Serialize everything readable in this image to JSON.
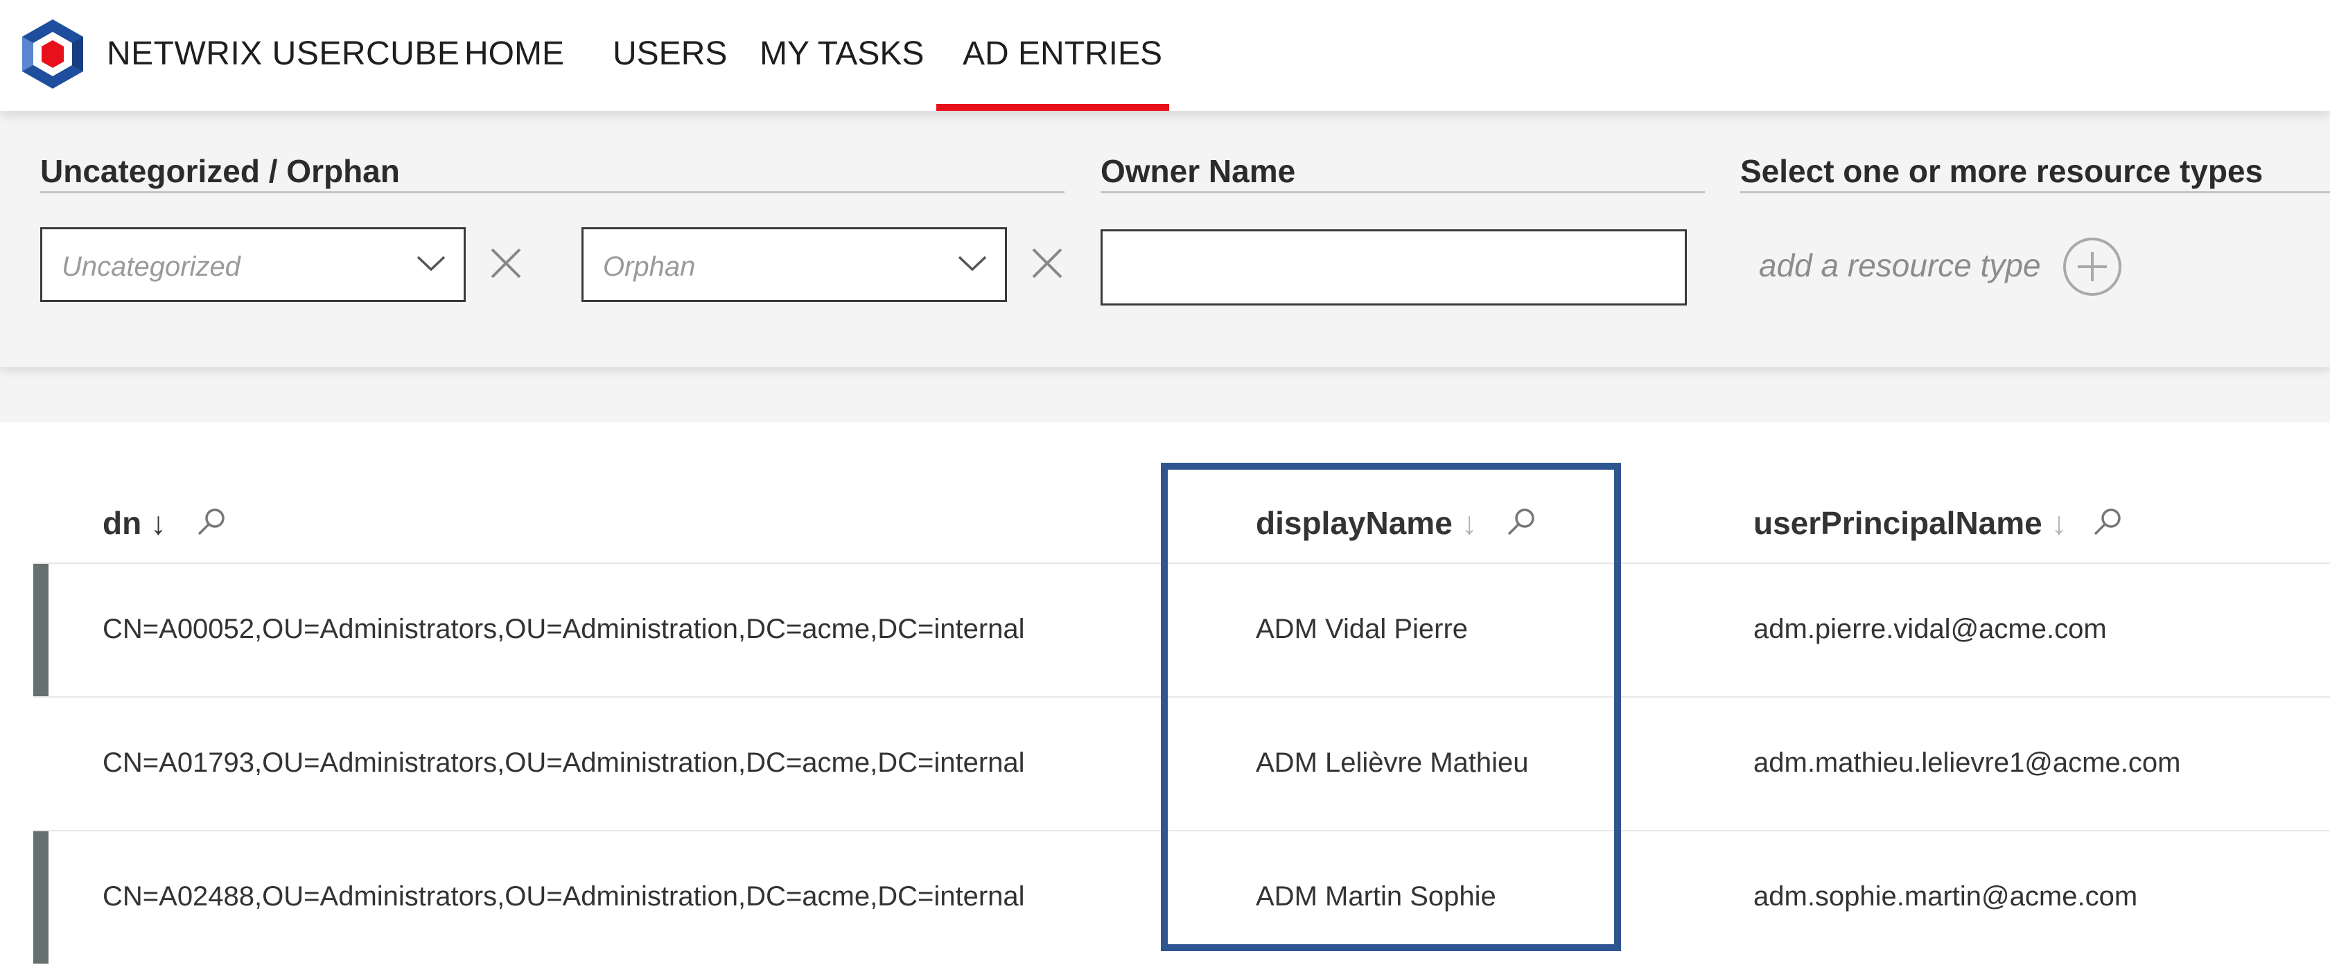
{
  "header": {
    "brand": "NETWRIX USERCUBE",
    "nav": [
      {
        "label": "HOME",
        "active": false
      },
      {
        "label": "USERS",
        "active": false
      },
      {
        "label": "MY TASKS",
        "active": false
      },
      {
        "label": "AD ENTRIES",
        "active": true
      }
    ],
    "accent_color": "#e8101b"
  },
  "filters": {
    "category_title": "Uncategorized / Orphan",
    "category_select_placeholder": "Uncategorized",
    "orphan_select_placeholder": "Orphan",
    "owner_title": "Owner Name",
    "owner_value": "",
    "resource_title": "Select one or more resource types",
    "resource_add_label": "add a resource type"
  },
  "table": {
    "columns": [
      {
        "label": "dn",
        "sort": "↓",
        "sort_active": true
      },
      {
        "label": "displayName",
        "sort": "↓",
        "sort_active": false
      },
      {
        "label": "userPrincipalName",
        "sort": "↓",
        "sort_active": false
      }
    ],
    "rows": [
      {
        "dn": "CN=A00052,OU=Administrators,OU=Administration,DC=acme,DC=internal",
        "displayName": "ADM Vidal Pierre",
        "userPrincipalName": "adm.pierre.vidal@acme.com",
        "flagged": true
      },
      {
        "dn": "CN=A01793,OU=Administrators,OU=Administration,DC=acme,DC=internal",
        "displayName": "ADM Lelièvre Mathieu",
        "userPrincipalName": "adm.mathieu.lelievre1@acme.com",
        "flagged": false
      },
      {
        "dn": "CN=A02488,OU=Administrators,OU=Administration,DC=acme,DC=internal",
        "displayName": "ADM Martin Sophie",
        "userPrincipalName": "adm.sophie.martin@acme.com",
        "flagged": true
      }
    ]
  },
  "highlight_color": "#2e5592"
}
